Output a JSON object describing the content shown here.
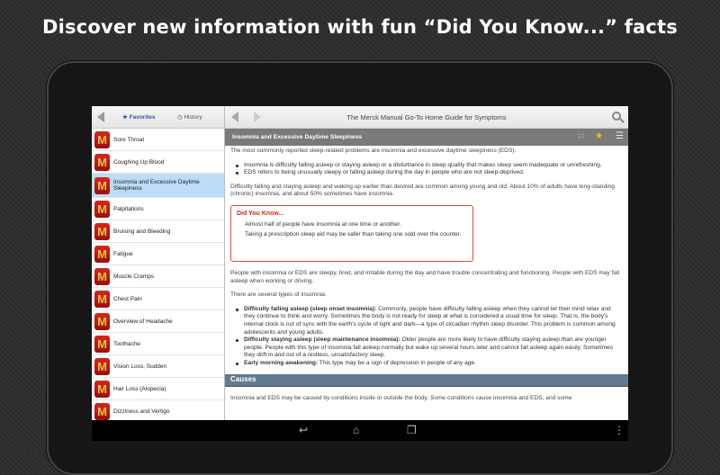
{
  "headline": "Discover new information with fun “Did You Know...” facts",
  "sidebar": {
    "tabs": [
      {
        "label": "Favorites",
        "icon": "star-icon"
      },
      {
        "label": "History",
        "icon": "clock-icon"
      }
    ],
    "items": [
      "Sore Throat",
      "Coughing Up Blood",
      "Insomnia and Excessive Daytime Sleepiness",
      "Palpitations",
      "Bruising and Bleeding",
      "Fatigue",
      "Muscle Cramps",
      "Chest Pain",
      "Overview of Headache",
      "Toothache",
      "Vision Loss, Sudden",
      "Hair Loss (Alopecia)",
      "Dizziness and Vertigo"
    ],
    "item_icon_letter": "M",
    "selected_index": 2
  },
  "toolbar": {
    "title": "The Merck Manual Go-To Home Guide for Symptoms"
  },
  "article": {
    "title": "Insomnia and Excessive Daytime Sleepiness",
    "intro": "The most commonly reported sleep-related problems are insomnia and excessive daytime sleepiness (EDS).",
    "bullets1": [
      "Insomnia is difficulty falling asleep or staying asleep or a disturbance in sleep quality that makes sleep seem inadequate or unrefreshing.",
      "EDS refers to being unusually sleepy or falling asleep during the day in people who are not sleep-deprived."
    ],
    "p2": "Difficulty falling and staying asleep and waking up earlier than desired are common among young and old. About 10% of adults have long-standing (chronic) insomnia, and about 50% sometimes have insomnia.",
    "dyk": {
      "title": "Did You Know...",
      "facts": [
        "Almost half of people have insomnia at one time or another.",
        "Taking a prescription sleep aid may be safer than taking one sold over the counter."
      ]
    },
    "p3": "People with insomnia or EDS are sleepy, tired, and irritable during the day and have trouble concentrating and functioning. People with EDS may fall asleep when working or driving.",
    "p4": "There are several types of insomnia:",
    "types": [
      {
        "term": "Difficulty falling asleep (sleep onset insomnia):",
        "text": " Commonly, people have difficulty falling asleep when they cannot let their mind relax and they continue to think and worry. Sometimes the body is not ready for sleep at what is considered a usual time for sleep. That is, the body's internal clock is out of sync with the earth's cycle of light and dark—a type of circadian rhythm sleep disorder. This problem is common among adolescents and young adults."
      },
      {
        "term": "Difficulty staying asleep (sleep maintenance insomnia):",
        "text": " Older people are more likely to have difficulty staying asleep than are younger people. People with this type of insomnia fall asleep normally but wake up several hours later and cannot fall asleep again easily. Sometimes they drift in and out of a restless, unsatisfactory sleep."
      },
      {
        "term": "Early morning awakening:",
        "text": " This type may be a sign of depression in people of any age."
      }
    ],
    "section": "Causes",
    "p5": "Insomnia and EDS may be caused by conditions inside or outside the body. Some conditions cause insomnia and EDS, and some"
  },
  "colors": {
    "accent": "#2a5aa8",
    "dyk_border": "#e04a3a",
    "section": "#617a91",
    "logo": "#c0190f"
  }
}
